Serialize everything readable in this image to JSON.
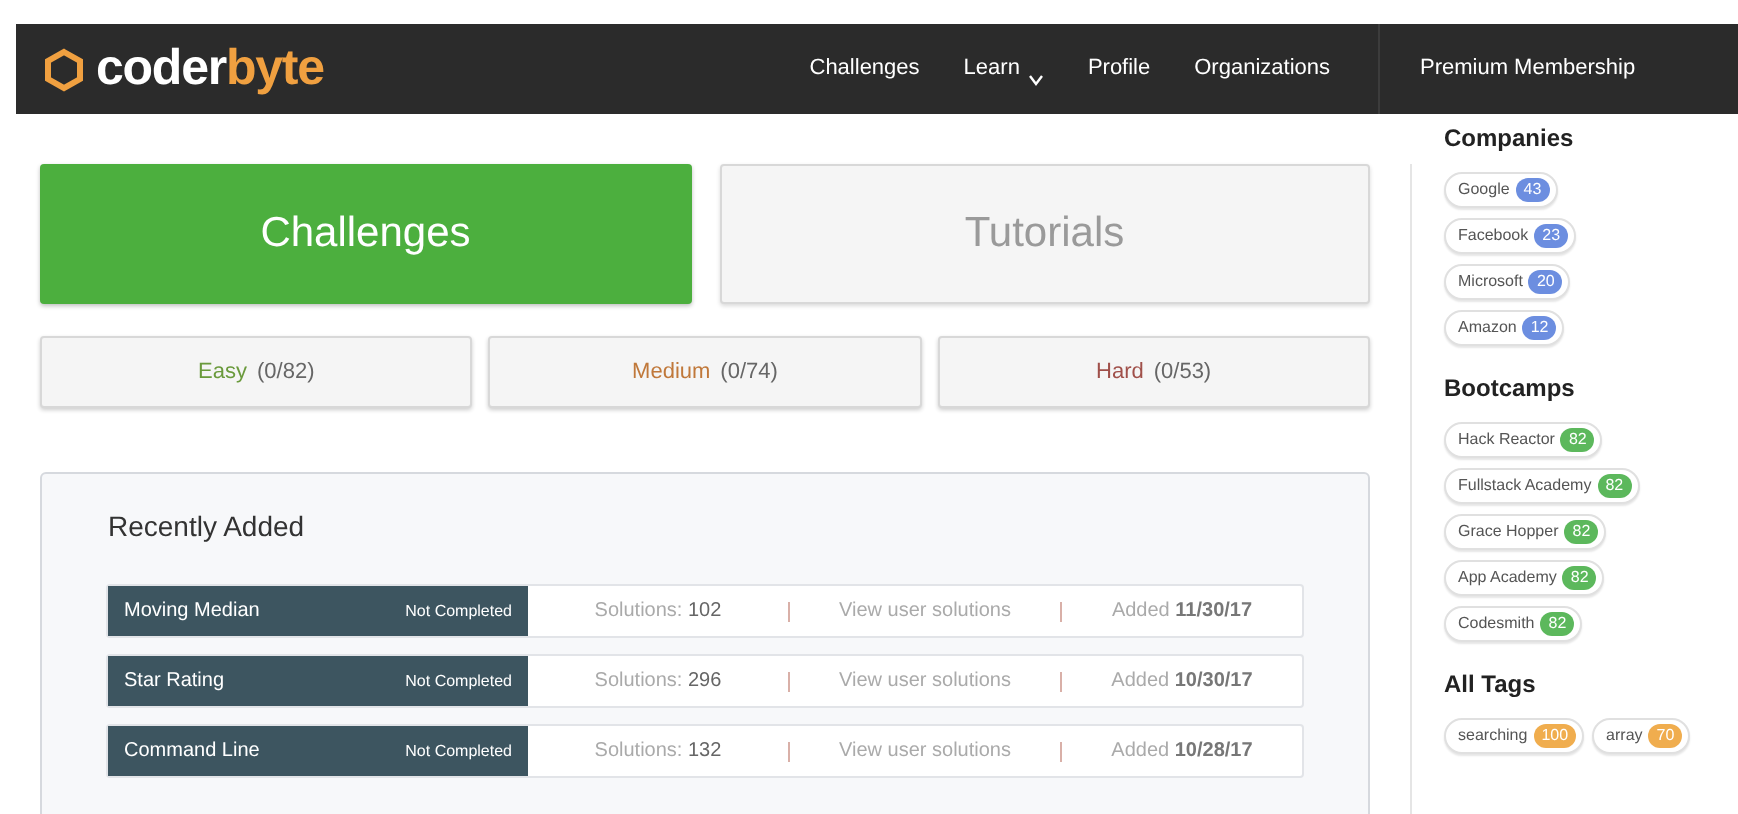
{
  "navbar": {
    "logo": {
      "first": "coder",
      "second": "byte"
    },
    "links": [
      {
        "label": "Challenges",
        "dropdown": false
      },
      {
        "label": "Learn",
        "dropdown": true
      },
      {
        "label": "Profile",
        "dropdown": false
      },
      {
        "label": "Organizations",
        "dropdown": false
      }
    ],
    "premium": "Premium Membership"
  },
  "mode_tabs": [
    {
      "label": "Challenges",
      "selected": true
    },
    {
      "label": "Tutorials",
      "selected": false
    }
  ],
  "difficulties": [
    {
      "label": "Easy",
      "count": "(0/82)",
      "color": "#6a9a3c"
    },
    {
      "label": "Medium",
      "count": "(0/74)",
      "color": "#c0783a"
    },
    {
      "label": "Hard",
      "count": "(0/53)",
      "color": "#a0504a"
    }
  ],
  "recently_added": {
    "title": "Recently Added",
    "rows": [
      {
        "name": "Moving Median",
        "status": "Not Completed",
        "solutions": "Solutions: **102**",
        "link": "View user solutions",
        "added": "Added **11/30/17**"
      },
      {
        "name": "Star Rating",
        "status": "Not Completed",
        "solutions": "Solutions: **296**",
        "link": "View user solutions",
        "added": "Added **10/30/17**"
      },
      {
        "name": "Command Line",
        "status": "Not Completed",
        "solutions": "Solutions: **132**",
        "link": "View user solutions",
        "added": "Added **10/28/17**"
      }
    ]
  },
  "sidebar": [
    {
      "title": "Companies",
      "color": "#6c8ee0",
      "tags": [
        {
          "label": "Google",
          "count": "43"
        },
        {
          "label": "Facebook",
          "count": "23"
        },
        {
          "label": "Microsoft",
          "count": "20"
        },
        {
          "label": "Amazon",
          "count": "12"
        }
      ]
    },
    {
      "title": "Bootcamps",
      "color": "#5cb85c",
      "tags": [
        {
          "label": "Hack Reactor",
          "count": "82"
        },
        {
          "label": "Fullstack Academy",
          "count": "82"
        },
        {
          "label": "Grace Hopper",
          "count": "82"
        },
        {
          "label": "App Academy",
          "count": "82"
        },
        {
          "label": "Codesmith",
          "count": "82"
        }
      ]
    },
    {
      "title": "All Tags",
      "color": "#f0ad4e",
      "inline": true,
      "tags": [
        {
          "label": "searching",
          "count": "100"
        },
        {
          "label": "array",
          "count": "70"
        }
      ]
    }
  ]
}
